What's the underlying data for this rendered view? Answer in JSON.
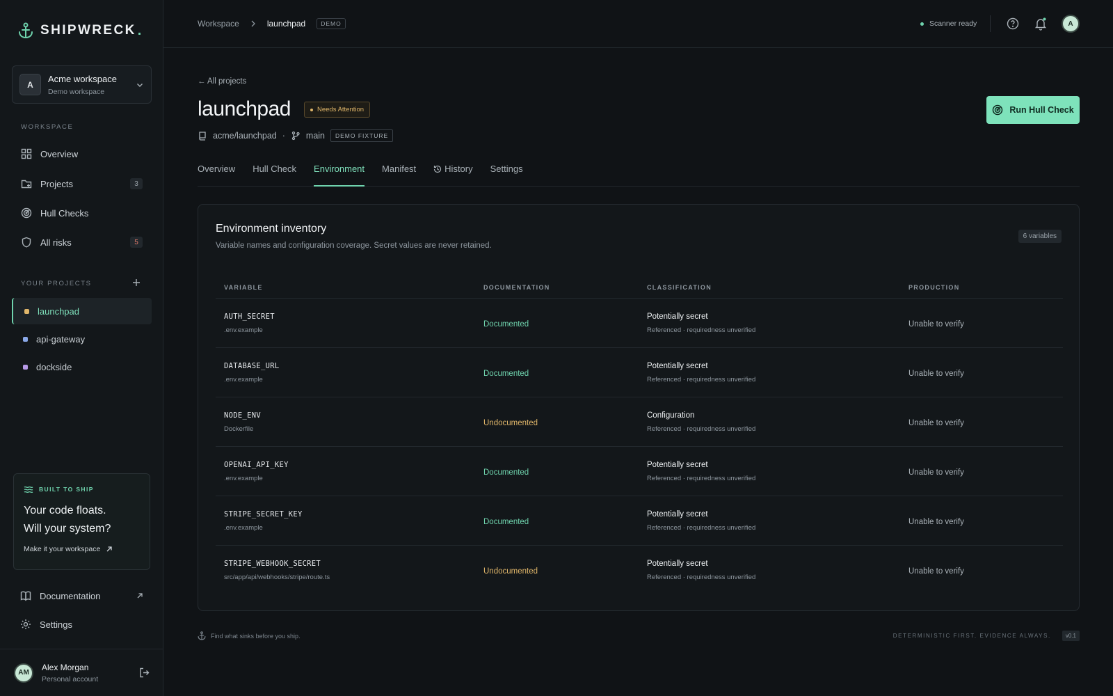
{
  "brand": {
    "name": "SHIPWRECK",
    "dot": "."
  },
  "workspace_switcher": {
    "initial": "A",
    "name": "Acme workspace",
    "sub": "Demo workspace"
  },
  "sidebar": {
    "workspace_label": "WORKSPACE",
    "items": [
      {
        "label": "Overview",
        "icon": "grid-icon"
      },
      {
        "label": "Projects",
        "icon": "folder-icon",
        "count": "3"
      },
      {
        "label": "Hull Checks",
        "icon": "radar-icon"
      },
      {
        "label": "All risks",
        "icon": "shield-icon",
        "count": "5"
      }
    ],
    "projects_label": "YOUR PROJECTS",
    "projects": [
      {
        "label": "launchpad",
        "color": "#e0b66a"
      },
      {
        "label": "api-gateway",
        "color": "#8aa8e8"
      },
      {
        "label": "dockside",
        "color": "#b79ae8"
      }
    ],
    "promo": {
      "tag": "BUILT TO SHIP",
      "line1": "Your code floats.",
      "line2": "Will your system?",
      "link": "Make it your workspace"
    },
    "documentation": "Documentation",
    "settings": "Settings",
    "user": {
      "initials": "AM",
      "name": "Alex Morgan",
      "sub": "Personal account"
    }
  },
  "topbar": {
    "crumb_root": "Workspace",
    "crumb_current": "launchpad",
    "crumb_badge": "DEMO",
    "scanner_status": "Scanner ready",
    "avatar_initial": "A"
  },
  "project": {
    "back_link": "← All projects",
    "title": "launchpad",
    "status": "Needs Attention",
    "repo": "acme/launchpad",
    "separator": "·",
    "branch": "main",
    "fixture": "DEMO FIXTURE",
    "run_button": "Run Hull Check"
  },
  "tabs": [
    "Overview",
    "Hull Check",
    "Environment",
    "Manifest",
    "History",
    "Settings"
  ],
  "inventory": {
    "title": "Environment inventory",
    "subtitle": "Variable names and configuration coverage. Secret values are never retained.",
    "count": "6 variables",
    "columns": [
      "VARIABLE",
      "DOCUMENTATION",
      "CLASSIFICATION",
      "PRODUCTION"
    ],
    "rows": [
      {
        "name": "AUTH_SECRET",
        "source": ".env.example",
        "doc": "Documented",
        "cls": "Potentially secret",
        "cls_sub": "Referenced · requiredness unverified",
        "prod": "Unable to verify"
      },
      {
        "name": "DATABASE_URL",
        "source": ".env.example",
        "doc": "Documented",
        "cls": "Potentially secret",
        "cls_sub": "Referenced · requiredness unverified",
        "prod": "Unable to verify"
      },
      {
        "name": "NODE_ENV",
        "source": "Dockerfile",
        "doc": "Undocumented",
        "cls": "Configuration",
        "cls_sub": "Referenced · requiredness unverified",
        "prod": "Unable to verify"
      },
      {
        "name": "OPENAI_API_KEY",
        "source": ".env.example",
        "doc": "Documented",
        "cls": "Potentially secret",
        "cls_sub": "Referenced · requiredness unverified",
        "prod": "Unable to verify"
      },
      {
        "name": "STRIPE_SECRET_KEY",
        "source": ".env.example",
        "doc": "Documented",
        "cls": "Potentially secret",
        "cls_sub": "Referenced · requiredness unverified",
        "prod": "Unable to verify"
      },
      {
        "name": "STRIPE_WEBHOOK_SECRET",
        "source": "src/app/api/webhooks/stripe/route.ts",
        "doc": "Undocumented",
        "cls": "Potentially secret",
        "cls_sub": "Referenced · requiredness unverified",
        "prod": "Unable to verify"
      }
    ]
  },
  "footer": {
    "tagline": "Find what sinks before you ship.",
    "motto": "DETERMINISTIC FIRST. EVIDENCE ALWAYS.",
    "version": "v0.1"
  },
  "colors": {
    "accent": "#6fd3ad",
    "warn": "#e0b66a",
    "danger": "#e07a6b",
    "bg": "#101316"
  }
}
